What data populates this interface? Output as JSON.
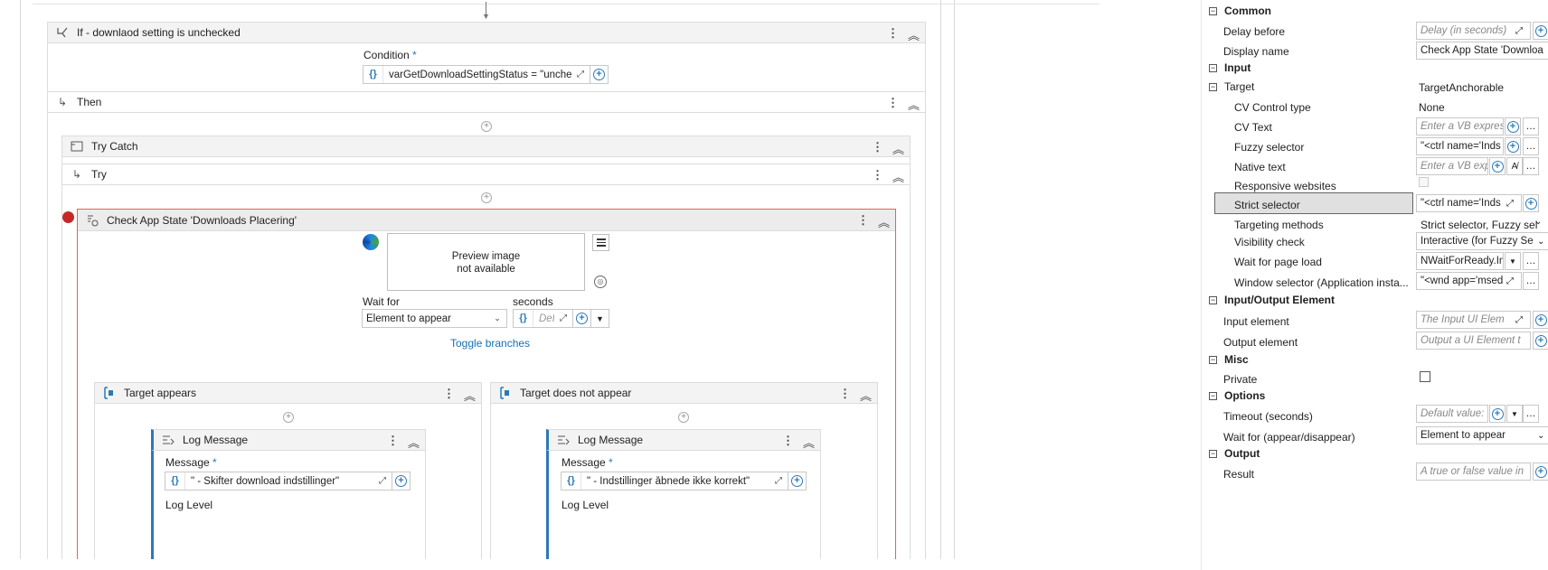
{
  "designer": {
    "if_activity": {
      "title": "If - downlaod setting is unchecked",
      "condition_label": "Condition",
      "condition_required": "*",
      "condition_value": "varGetDownloadSettingStatus = \"uncheck"
    },
    "then_label": "Then",
    "try_catch": {
      "title": "Try Catch",
      "try_label": "Try"
    },
    "check_app_state": {
      "title": "Check App State 'Downloads Placering'",
      "preview_text_1": "Preview image",
      "preview_text_2": "not available",
      "wait_for_label": "Wait for",
      "wait_for_value": "Element to appear",
      "seconds_label": "seconds",
      "seconds_placeholder": "Defa",
      "toggle_branches": "Toggle branches"
    },
    "target_appears": {
      "title": "Target appears",
      "log_title": "Log Message",
      "message_label": "Message",
      "message_required": "*",
      "message_value": "\" - Skifter download indstillinger\"",
      "log_level_label": "Log Level"
    },
    "target_not_appear": {
      "title": "Target does not appear",
      "log_title": "Log Message",
      "message_label": "Message",
      "message_required": "*",
      "message_value": "\" - Indstillinger åbnede ikke korrekt\"",
      "log_level_label": "Log Level"
    }
  },
  "properties": {
    "sections": {
      "common": "Common",
      "input": "Input",
      "io_element": "Input/Output Element",
      "misc": "Misc",
      "options": "Options",
      "output": "Output"
    },
    "rows": {
      "delay_before": {
        "name": "Delay before",
        "value": "Delay (in seconds)"
      },
      "display_name": {
        "name": "Display name",
        "value": "Check App State 'Downloa"
      },
      "target": {
        "name": "Target",
        "value": "TargetAnchorable"
      },
      "cv_control_type": {
        "name": "CV Control type",
        "value": "None"
      },
      "cv_text": {
        "name": "CV Text",
        "value": "Enter a VB express"
      },
      "fuzzy_selector": {
        "name": "Fuzzy selector",
        "value": "\"<ctrl name='Inds"
      },
      "native_text": {
        "name": "Native text",
        "value": "Enter a VB exp"
      },
      "responsive_websites": {
        "name": "Responsive websites"
      },
      "strict_selector": {
        "name": "Strict selector",
        "value": "\"<ctrl name='Inds"
      },
      "targeting_methods": {
        "name": "Targeting methods",
        "value": "Strict selector, Fuzzy sel"
      },
      "visibility_check": {
        "name": "Visibility check",
        "value": "Interactive (for Fuzzy Se"
      },
      "wait_for_page_load": {
        "name": "Wait for page load",
        "value": "NWaitForReady.In"
      },
      "window_selector": {
        "name": "Window selector (Application insta...",
        "value": "\"<wnd app='msed"
      },
      "input_element": {
        "name": "Input element",
        "value": "The Input UI Elem"
      },
      "output_element": {
        "name": "Output element",
        "value": "Output a UI Element t"
      },
      "private": {
        "name": "Private"
      },
      "timeout": {
        "name": "Timeout (seconds)",
        "value": "Default value:"
      },
      "wait_appear": {
        "name": "Wait for (appear/disappear)",
        "value": "Element to appear"
      },
      "result": {
        "name": "Result",
        "value": "A true or false value in"
      }
    }
  },
  "icons": {
    "collapse": "double-chevron-up",
    "menu": "three-dot-kebab",
    "expand": "expand-arrows",
    "add": "plus-circle"
  },
  "colors": {
    "accent": "#2a7ab9",
    "selected_border": "#e8643c",
    "breakpoint": "#c62828"
  }
}
